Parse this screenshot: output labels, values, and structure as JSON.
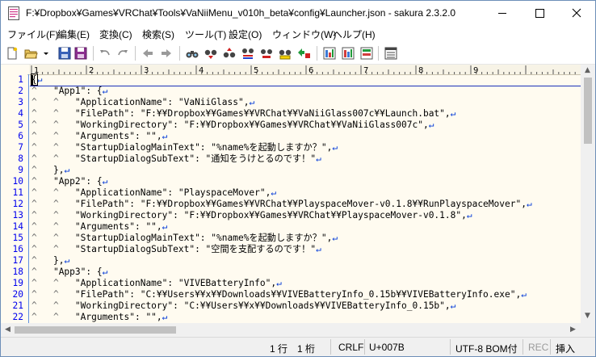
{
  "window": {
    "title": "F:¥Dropbox¥Games¥VRChat¥Tools¥VaNiiMenu_v010h_beta¥config¥Launcher.json - sakura 2.3.2.0"
  },
  "menubar": {
    "items": [
      "ファイル(F)",
      "編集(E)",
      "変換(C)",
      "検索(S)",
      "ツール(T)",
      "設定(O)",
      "ウィンドウ(W)",
      "ヘルプ(H)"
    ]
  },
  "toolbar": {
    "buttons": [
      "new-file",
      "open-file",
      "open-dropdown",
      "save",
      "save-all",
      "undo",
      "redo",
      "jump-back",
      "jump-forward",
      "search-prev",
      "search-next",
      "search-up",
      "search-down",
      "search-mark",
      "grep",
      "jump-tag",
      "outline",
      "settings-common",
      "settings-type",
      "settings-font",
      "window-tile"
    ]
  },
  "ruler": {
    "marks": [
      "1",
      "2",
      "3",
      "4",
      "5",
      "6",
      "7",
      "8",
      "9"
    ]
  },
  "editor": {
    "line_numbers": [
      "1",
      "2",
      "3",
      "4",
      "5",
      "6",
      "7",
      "8",
      "9",
      "10",
      "11",
      "12",
      "13",
      "14",
      "15",
      "16",
      "17",
      "18",
      "19",
      "20",
      "21",
      "22"
    ],
    "eol_mark": "↵",
    "tab_mark": "^",
    "lines": [
      {
        "indent": "",
        "text": "{"
      },
      {
        "indent": "^   ",
        "text": "\"App1\": {"
      },
      {
        "indent": "^   ^   ",
        "text": "\"ApplicationName\": \"VaNiiGlass\","
      },
      {
        "indent": "^   ^   ",
        "text": "\"FilePath\": \"F:¥¥Dropbox¥¥Games¥¥VRChat¥¥VaNiiGlass007c¥¥Launch.bat\","
      },
      {
        "indent": "^   ^   ",
        "text": "\"WorkingDirectory\": \"F:¥¥Dropbox¥¥Games¥¥VRChat¥¥VaNiiGlass007c\","
      },
      {
        "indent": "^   ^   ",
        "text": "\"Arguments\": \"\","
      },
      {
        "indent": "^   ^   ",
        "text": "\"StartupDialogMainText\": \"%name%を起動しますか？\","
      },
      {
        "indent": "^   ^   ",
        "text": "\"StartupDialogSubText\": \"通知をうけとるのです！\""
      },
      {
        "indent": "^   ",
        "text": "},"
      },
      {
        "indent": "^   ",
        "text": "\"App2\": {"
      },
      {
        "indent": "^   ^   ",
        "text": "\"ApplicationName\": \"PlayspaceMover\","
      },
      {
        "indent": "^   ^   ",
        "text": "\"FilePath\": \"F:¥¥Dropbox¥¥Games¥¥VRChat¥¥PlayspaceMover-v0.1.8¥¥RunPlayspaceMover\","
      },
      {
        "indent": "^   ^   ",
        "text": "\"WorkingDirectory\": \"F:¥¥Dropbox¥¥Games¥¥VRChat¥¥PlayspaceMover-v0.1.8\","
      },
      {
        "indent": "^   ^   ",
        "text": "\"Arguments\": \"\","
      },
      {
        "indent": "^   ^   ",
        "text": "\"StartupDialogMainText\": \"%name%を起動しますか？\","
      },
      {
        "indent": "^   ^   ",
        "text": "\"StartupDialogSubText\": \"空間を支配するのです！\""
      },
      {
        "indent": "^   ",
        "text": "},"
      },
      {
        "indent": "^   ",
        "text": "\"App3\": {"
      },
      {
        "indent": "^   ^   ",
        "text": "\"ApplicationName\": \"VIVEBatteryInfo\","
      },
      {
        "indent": "^   ^   ",
        "text": "\"FilePath\": \"C:¥¥Users¥¥x¥¥Downloads¥¥VIVEBatteryInfo_0.15b¥¥VIVEBatteryInfo.exe\","
      },
      {
        "indent": "^   ^   ",
        "text": "\"WorkingDirectory\": \"C:¥¥Users¥¥x¥¥Downloads¥¥VIVEBatteryInfo_0.15b\","
      },
      {
        "indent": "^   ^   ",
        "text": "\"Arguments\": \"\","
      }
    ]
  },
  "statusbar": {
    "position": "1 行　1 桁",
    "line_ending": "CRLF",
    "char_code": "U+007B",
    "encoding": "UTF-8 BOM付",
    "rec": "REC",
    "mode": "挿入"
  },
  "colors": {
    "editor_bg": "#fffbf0",
    "line_number": "#0000ee",
    "eol_mark": "#0038d8",
    "tab_mark": "#6e6e6e",
    "cursor_line": "#1a31b8"
  }
}
